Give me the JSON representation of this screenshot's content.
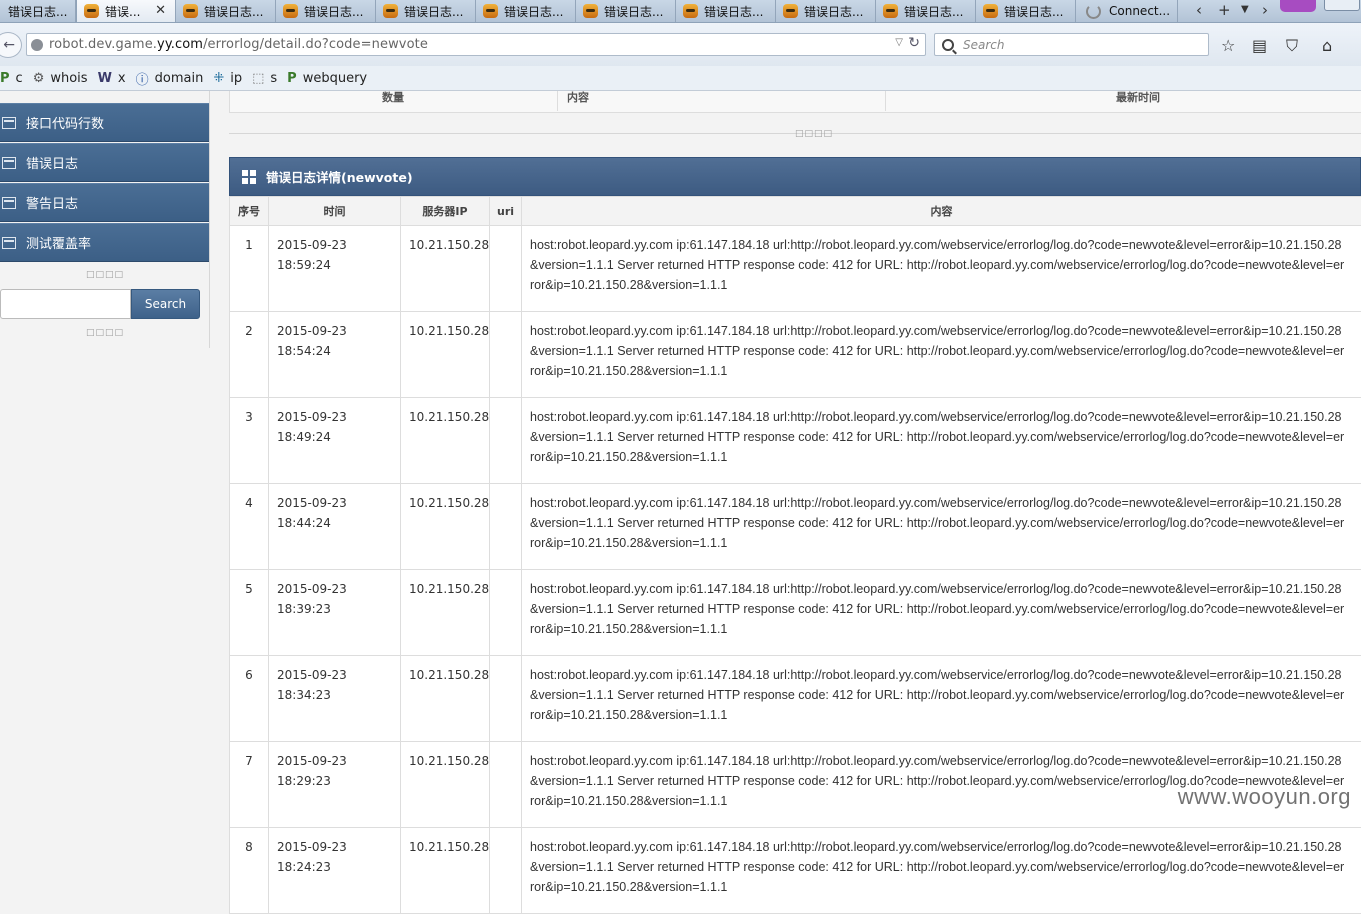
{
  "browser": {
    "tabs": [
      {
        "label": "错误日志..."
      },
      {
        "label": "错误...",
        "active": true
      },
      {
        "label": "错误日志..."
      },
      {
        "label": "错误日志..."
      },
      {
        "label": "错误日志..."
      },
      {
        "label": "错误日志..."
      },
      {
        "label": "错误日志..."
      },
      {
        "label": "错误日志..."
      },
      {
        "label": "错误日志..."
      },
      {
        "label": "错误日志..."
      },
      {
        "label": "错误日志..."
      },
      {
        "label": "Connect..."
      }
    ],
    "tab_close_glyph": "✕",
    "new_tab_glyph": "+",
    "url_prefix": "robot.dev.game.",
    "url_domain": "yy.com",
    "url_path": "/errorlog/detail.do?code=newvote",
    "search_placeholder": "Search",
    "bookmarks": [
      {
        "icon": "P",
        "label": "c"
      },
      {
        "icon": "gear",
        "label": "whois"
      },
      {
        "icon": "W",
        "label": "x"
      },
      {
        "icon": "info",
        "label": "domain"
      },
      {
        "icon": "puzzle",
        "label": "ip"
      },
      {
        "icon": "square",
        "label": "s"
      },
      {
        "icon": "P",
        "label": "webquery"
      }
    ]
  },
  "sidebar": {
    "items": [
      {
        "label": "接口代码行数"
      },
      {
        "label": "错误日志"
      },
      {
        "label": "警告日志"
      },
      {
        "label": "测试覆盖率"
      }
    ],
    "search_button": "Search",
    "search_value": ""
  },
  "summary_table": {
    "headers": [
      "数量",
      "内容",
      "最新时间"
    ]
  },
  "panel": {
    "title": "错误日志详情(newvote)"
  },
  "detail_table": {
    "headers": [
      "序号",
      "时间",
      "服务器IP",
      "uri",
      "内容"
    ],
    "rows": [
      {
        "idx": "1",
        "time": "2015-09-23 18:59:24",
        "ip": "10.21.150.28",
        "uri": "",
        "content": "host:robot.leopard.yy.com ip:61.147.184.18 url:http://robot.leopard.yy.com/webservice/errorlog/log.do?code=newvote&level=error&ip=10.21.150.28&version=1.1.1 Server returned HTTP response code: 412 for URL: http://robot.leopard.yy.com/webservice/errorlog/log.do?code=newvote&level=error&ip=10.21.150.28&version=1.1.1"
      },
      {
        "idx": "2",
        "time": "2015-09-23 18:54:24",
        "ip": "10.21.150.28",
        "uri": "",
        "content": "host:robot.leopard.yy.com ip:61.147.184.18 url:http://robot.leopard.yy.com/webservice/errorlog/log.do?code=newvote&level=error&ip=10.21.150.28&version=1.1.1 Server returned HTTP response code: 412 for URL: http://robot.leopard.yy.com/webservice/errorlog/log.do?code=newvote&level=error&ip=10.21.150.28&version=1.1.1"
      },
      {
        "idx": "3",
        "time": "2015-09-23 18:49:24",
        "ip": "10.21.150.28",
        "uri": "",
        "content": "host:robot.leopard.yy.com ip:61.147.184.18 url:http://robot.leopard.yy.com/webservice/errorlog/log.do?code=newvote&level=error&ip=10.21.150.28&version=1.1.1 Server returned HTTP response code: 412 for URL: http://robot.leopard.yy.com/webservice/errorlog/log.do?code=newvote&level=error&ip=10.21.150.28&version=1.1.1"
      },
      {
        "idx": "4",
        "time": "2015-09-23 18:44:24",
        "ip": "10.21.150.28",
        "uri": "",
        "content": "host:robot.leopard.yy.com ip:61.147.184.18 url:http://robot.leopard.yy.com/webservice/errorlog/log.do?code=newvote&level=error&ip=10.21.150.28&version=1.1.1 Server returned HTTP response code: 412 for URL: http://robot.leopard.yy.com/webservice/errorlog/log.do?code=newvote&level=error&ip=10.21.150.28&version=1.1.1"
      },
      {
        "idx": "5",
        "time": "2015-09-23 18:39:23",
        "ip": "10.21.150.28",
        "uri": "",
        "content": "host:robot.leopard.yy.com ip:61.147.184.18 url:http://robot.leopard.yy.com/webservice/errorlog/log.do?code=newvote&level=error&ip=10.21.150.28&version=1.1.1 Server returned HTTP response code: 412 for URL: http://robot.leopard.yy.com/webservice/errorlog/log.do?code=newvote&level=error&ip=10.21.150.28&version=1.1.1"
      },
      {
        "idx": "6",
        "time": "2015-09-23 18:34:23",
        "ip": "10.21.150.28",
        "uri": "",
        "content": "host:robot.leopard.yy.com ip:61.147.184.18 url:http://robot.leopard.yy.com/webservice/errorlog/log.do?code=newvote&level=error&ip=10.21.150.28&version=1.1.1 Server returned HTTP response code: 412 for URL: http://robot.leopard.yy.com/webservice/errorlog/log.do?code=newvote&level=error&ip=10.21.150.28&version=1.1.1"
      },
      {
        "idx": "7",
        "time": "2015-09-23 18:29:23",
        "ip": "10.21.150.28",
        "uri": "",
        "content": "host:robot.leopard.yy.com ip:61.147.184.18 url:http://robot.leopard.yy.com/webservice/errorlog/log.do?code=newvote&level=error&ip=10.21.150.28&version=1.1.1 Server returned HTTP response code: 412 for URL: http://robot.leopard.yy.com/webservice/errorlog/log.do?code=newvote&level=error&ip=10.21.150.28&version=1.1.1"
      },
      {
        "idx": "8",
        "time": "2015-09-23 18:24:23",
        "ip": "10.21.150.28",
        "uri": "",
        "content": "host:robot.leopard.yy.com ip:61.147.184.18 url:http://robot.leopard.yy.com/webservice/errorlog/log.do?code=newvote&level=error&ip=10.21.150.28&version=1.1.1 Server returned HTTP response code: 412 for URL: http://robot.leopard.yy.com/webservice/errorlog/log.do?code=newvote&level=error&ip=10.21.150.28&version=1.1.1"
      }
    ]
  },
  "watermark": "www.wooyun.org",
  "colors": {
    "nav_blue": "#3c5f86",
    "panel_blue": "#46648b",
    "border": "#dddddd"
  }
}
